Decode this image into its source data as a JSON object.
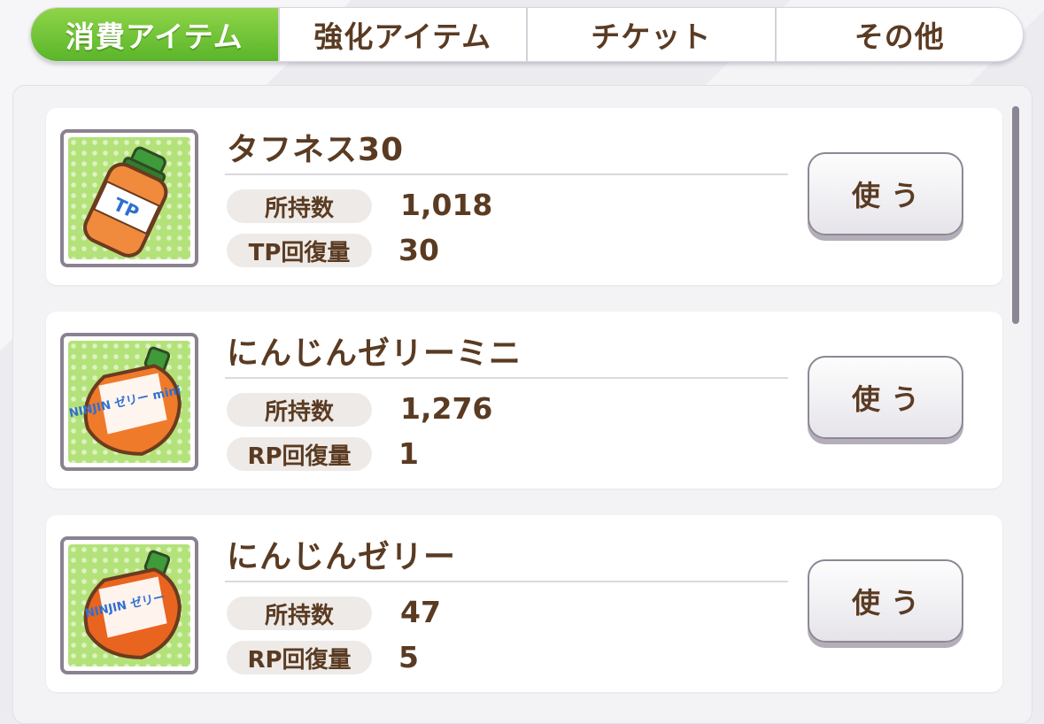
{
  "tabs": [
    {
      "label": "消費アイテム",
      "active": true
    },
    {
      "label": "強化アイテム",
      "active": false
    },
    {
      "label": "チケット",
      "active": false
    },
    {
      "label": "その他",
      "active": false
    }
  ],
  "items": [
    {
      "name": "タフネス30",
      "icon": "tp-bottle-icon",
      "icon_text": "TP",
      "stat1_label": "所持数",
      "stat1_value": "1,018",
      "stat2_label": "TP回復量",
      "stat2_value": "30",
      "use_label": "使う"
    },
    {
      "name": "にんじんゼリーミニ",
      "icon": "carrot-jelly-mini-icon",
      "icon_text": "NINJIN ゼリー mini",
      "stat1_label": "所持数",
      "stat1_value": "1,276",
      "stat2_label": "RP回復量",
      "stat2_value": "1",
      "use_label": "使う"
    },
    {
      "name": "にんじんゼリー",
      "icon": "carrot-jelly-icon",
      "icon_text": "NINJIN ゼリー",
      "stat1_label": "所持数",
      "stat1_value": "47",
      "stat2_label": "RP回復量",
      "stat2_value": "5",
      "use_label": "使う"
    }
  ],
  "colors": {
    "active_tab": "#6cc233",
    "text_brown": "#5a3b22",
    "icon_bg_green": "#b4e27a"
  }
}
